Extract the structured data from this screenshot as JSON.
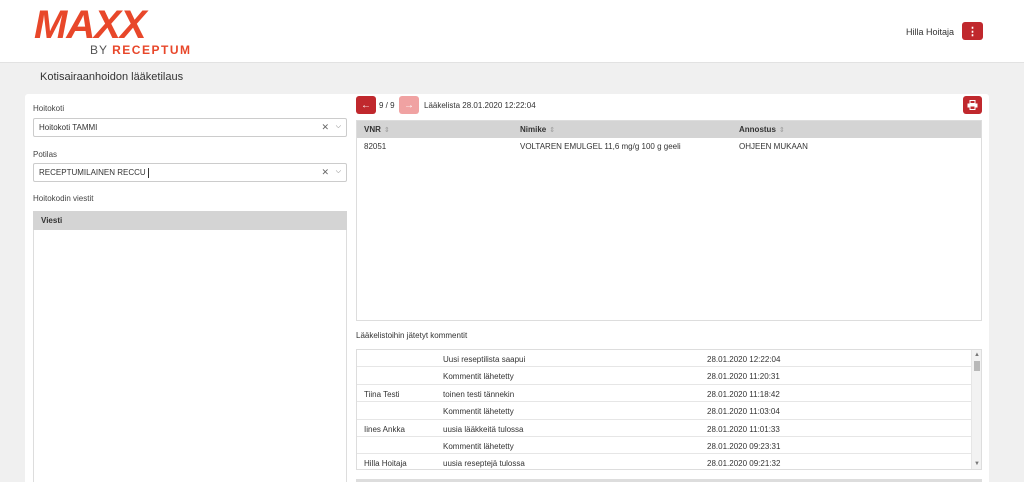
{
  "header": {
    "logo_main": "MAXX",
    "logo_by": "BY",
    "logo_brand": "RECEPTUM",
    "user_name": "Hilla Hoitaja",
    "menu_icon": "kebab-menu-icon"
  },
  "page": {
    "title": "Kotisairaanhoidon lääketilaus"
  },
  "form": {
    "hoitokoti_label": "Hoitokoti",
    "hoitokoti_value": "Hoitokoti TAMMI",
    "potilas_label": "Potilas",
    "potilas_value": "RECEPTUMILAINEN RECCU",
    "messages_label": "Hoitokodin viestit",
    "messages_column": "Viesti"
  },
  "medlist": {
    "counter": "9 / 9",
    "title": "Lääkelista 28.01.2020 12:22:04",
    "columns": [
      "VNR",
      "Nimike",
      "Annostus"
    ],
    "rows": [
      {
        "vnr": "82051",
        "nimike": "VOLTAREN EMULGEL 11,6 mg/g 100 g geeli",
        "annostus": "OHJEEN MUKAAN"
      }
    ]
  },
  "comments": {
    "label": "Lääkelistoihin jätetyt kommentit",
    "rows": [
      {
        "author": "",
        "text": "Uusi reseptilista saapui",
        "time": "28.01.2020 12:22:04"
      },
      {
        "author": "",
        "text": "Kommentit lähetetty",
        "time": "28.01.2020 11:20:31"
      },
      {
        "author": "Tiina Testi",
        "text": "toinen testi tännekin",
        "time": "28.01.2020 11:18:42"
      },
      {
        "author": "",
        "text": "Kommentit lähetetty",
        "time": "28.01.2020 11:03:04"
      },
      {
        "author": "Iines Ankka",
        "text": "uusia lääkkeitä tulossa",
        "time": "28.01.2020 11:01:33"
      },
      {
        "author": "",
        "text": "Kommentit lähetetty",
        "time": "28.01.2020 09:23:31"
      },
      {
        "author": "Hilla Hoitaja",
        "text": "uusia reseptejä tulossa",
        "time": "28.01.2020 09:21:32"
      }
    ]
  },
  "colors": {
    "accent": "#c0282d",
    "brand": "#e8472a"
  }
}
